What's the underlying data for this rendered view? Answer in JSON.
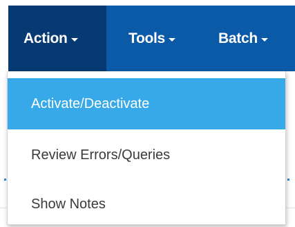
{
  "menubar": {
    "menus": [
      {
        "label": "Action",
        "active": true
      },
      {
        "label": "Tools",
        "active": false
      },
      {
        "label": "Batch",
        "active": false
      }
    ]
  },
  "dropdown": {
    "items": [
      {
        "label": "Activate/Deactivate",
        "selected": true
      },
      {
        "label": "Review Errors/Queries",
        "selected": false
      },
      {
        "label": "Show Notes",
        "selected": false
      }
    ]
  },
  "colors": {
    "menubar_bg": "#0a5aa8",
    "active_menu_bg": "#073a73",
    "highlight_bg": "#38a9e8",
    "item_text": "#3a3a3a"
  },
  "icons": {
    "caret": "caret-down-icon"
  }
}
